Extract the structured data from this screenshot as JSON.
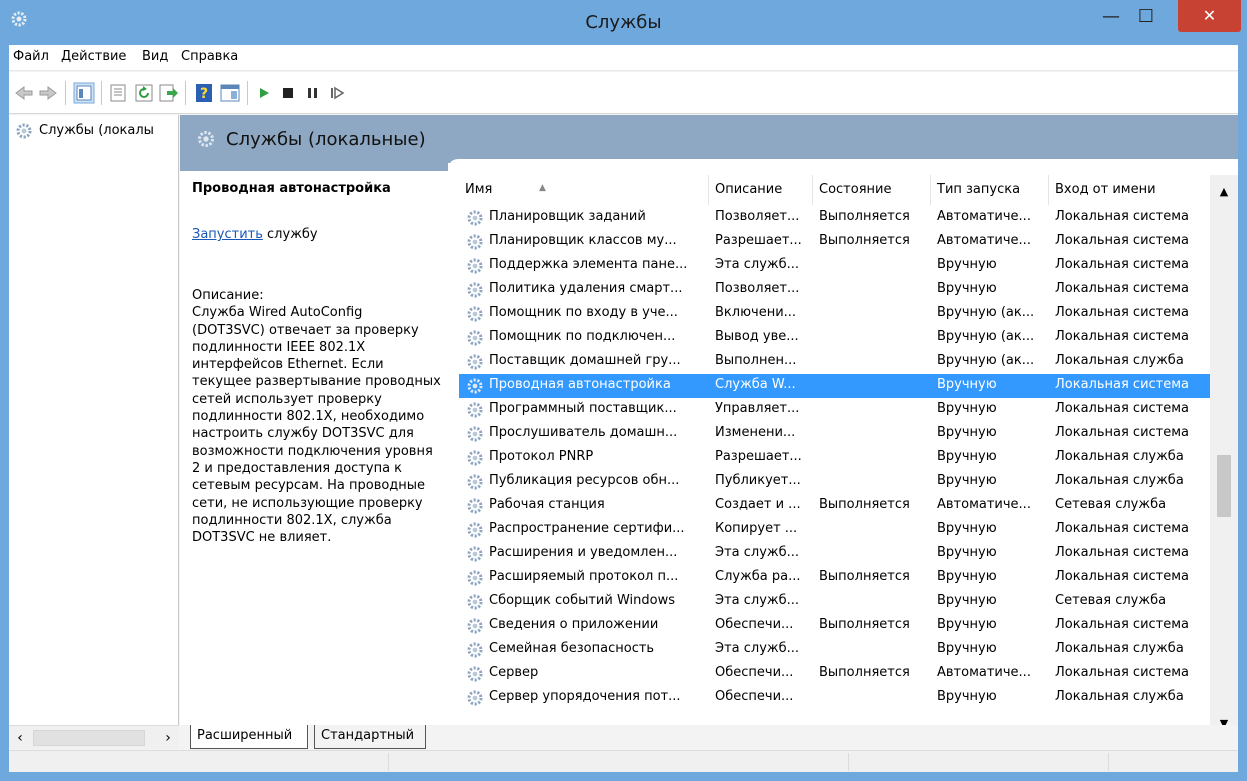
{
  "window": {
    "title": "Службы",
    "minimize_glyph": "—",
    "maximize_glyph": "☐",
    "close_glyph": "✕"
  },
  "menu": [
    "Файл",
    "Действие",
    "Вид",
    "Справка"
  ],
  "tree": {
    "item": "Службы (локалы"
  },
  "banner": {
    "title": "Службы (локальные)"
  },
  "desc": {
    "title": "Проводная автонастройка",
    "start_link": "Запустить",
    "start_suffix": " службу",
    "body": "Описание:\nСлужба Wired AutoConfig\n(DOT3SVC) отвечает за проверку\nподлинности IEEE 802.1X\nинтерфейсов Ethernet. Если\nтекущее развертывание проводных\nсетей использует проверку\nподлинности 802.1X, необходимо\nнастроить службу DOT3SVC для\nвозможности подключения уровня\n2 и предоставления доступа к\nсетевым ресурсам. На проводные\nсети, не использующие проверку\nподлинности 802.1X, служба\nDOT3SVC не влияет."
  },
  "columns": [
    "Имя",
    "Описание",
    "Состояние",
    "Тип запуска",
    "Вход от имени"
  ],
  "rows": [
    [
      "Планировщик заданий",
      "Позволяет...",
      "Выполняется",
      "Автоматиче...",
      "Локальная система"
    ],
    [
      "Планировщик классов му...",
      "Разрешает...",
      "Выполняется",
      "Автоматиче...",
      "Локальная система"
    ],
    [
      "Поддержка элемента пане...",
      "Эта служб...",
      "",
      "Вручную",
      "Локальная система"
    ],
    [
      "Политика удаления смарт...",
      "Позволяет...",
      "",
      "Вручную",
      "Локальная система"
    ],
    [
      "Помощник по входу в уче...",
      "Включени...",
      "",
      "Вручную (ак...",
      "Локальная система"
    ],
    [
      "Помощник по подключен...",
      "Вывод уве...",
      "",
      "Вручную (ак...",
      "Локальная система"
    ],
    [
      "Поставщик домашней гру...",
      "Выполнен...",
      "",
      "Вручную (ак...",
      "Локальная служба"
    ],
    [
      "Проводная автонастройка",
      "Служба W...",
      "",
      "Вручную",
      "Локальная система"
    ],
    [
      "Программный поставщик...",
      "Управляет...",
      "",
      "Вручную",
      "Локальная система"
    ],
    [
      "Прослушиватель домашн...",
      "Изменени...",
      "",
      "Вручную",
      "Локальная система"
    ],
    [
      "Протокол PNRP",
      "Разрешает...",
      "",
      "Вручную",
      "Локальная служба"
    ],
    [
      "Публикация ресурсов обн...",
      "Публикует...",
      "",
      "Вручную",
      "Локальная служба"
    ],
    [
      "Рабочая станция",
      "Создает и ...",
      "Выполняется",
      "Автоматиче...",
      "Сетевая служба"
    ],
    [
      "Распространение сертифи...",
      "Копирует ...",
      "",
      "Вручную",
      "Локальная система"
    ],
    [
      "Расширения и уведомлен...",
      "Эта служб...",
      "",
      "Вручную",
      "Локальная система"
    ],
    [
      "Расширяемый протокол п...",
      "Служба ра...",
      "Выполняется",
      "Вручную",
      "Локальная система"
    ],
    [
      "Сборщик событий Windows",
      "Эта служб...",
      "",
      "Вручную",
      "Сетевая служба"
    ],
    [
      "Сведения о приложении",
      "Обеспечи...",
      "Выполняется",
      "Вручную",
      "Локальная система"
    ],
    [
      "Семейная безопасность",
      "Эта служб...",
      "",
      "Вручную",
      "Локальная служба"
    ],
    [
      "Сервер",
      "Обеспечи...",
      "Выполняется",
      "Автоматиче...",
      "Локальная система"
    ],
    [
      "Сервер упорядочения пот...",
      "Обеспечи...",
      "",
      "Вручную",
      "Локальная служба"
    ]
  ],
  "selected_row": 7,
  "tabs": [
    "Расширенный",
    "Стандартный"
  ],
  "colors": {
    "selection": "#3399ff",
    "banner": "#8ea8c4",
    "titlebar": "#6fa8dc",
    "close": "#c74233",
    "link": "#1a57b8"
  }
}
